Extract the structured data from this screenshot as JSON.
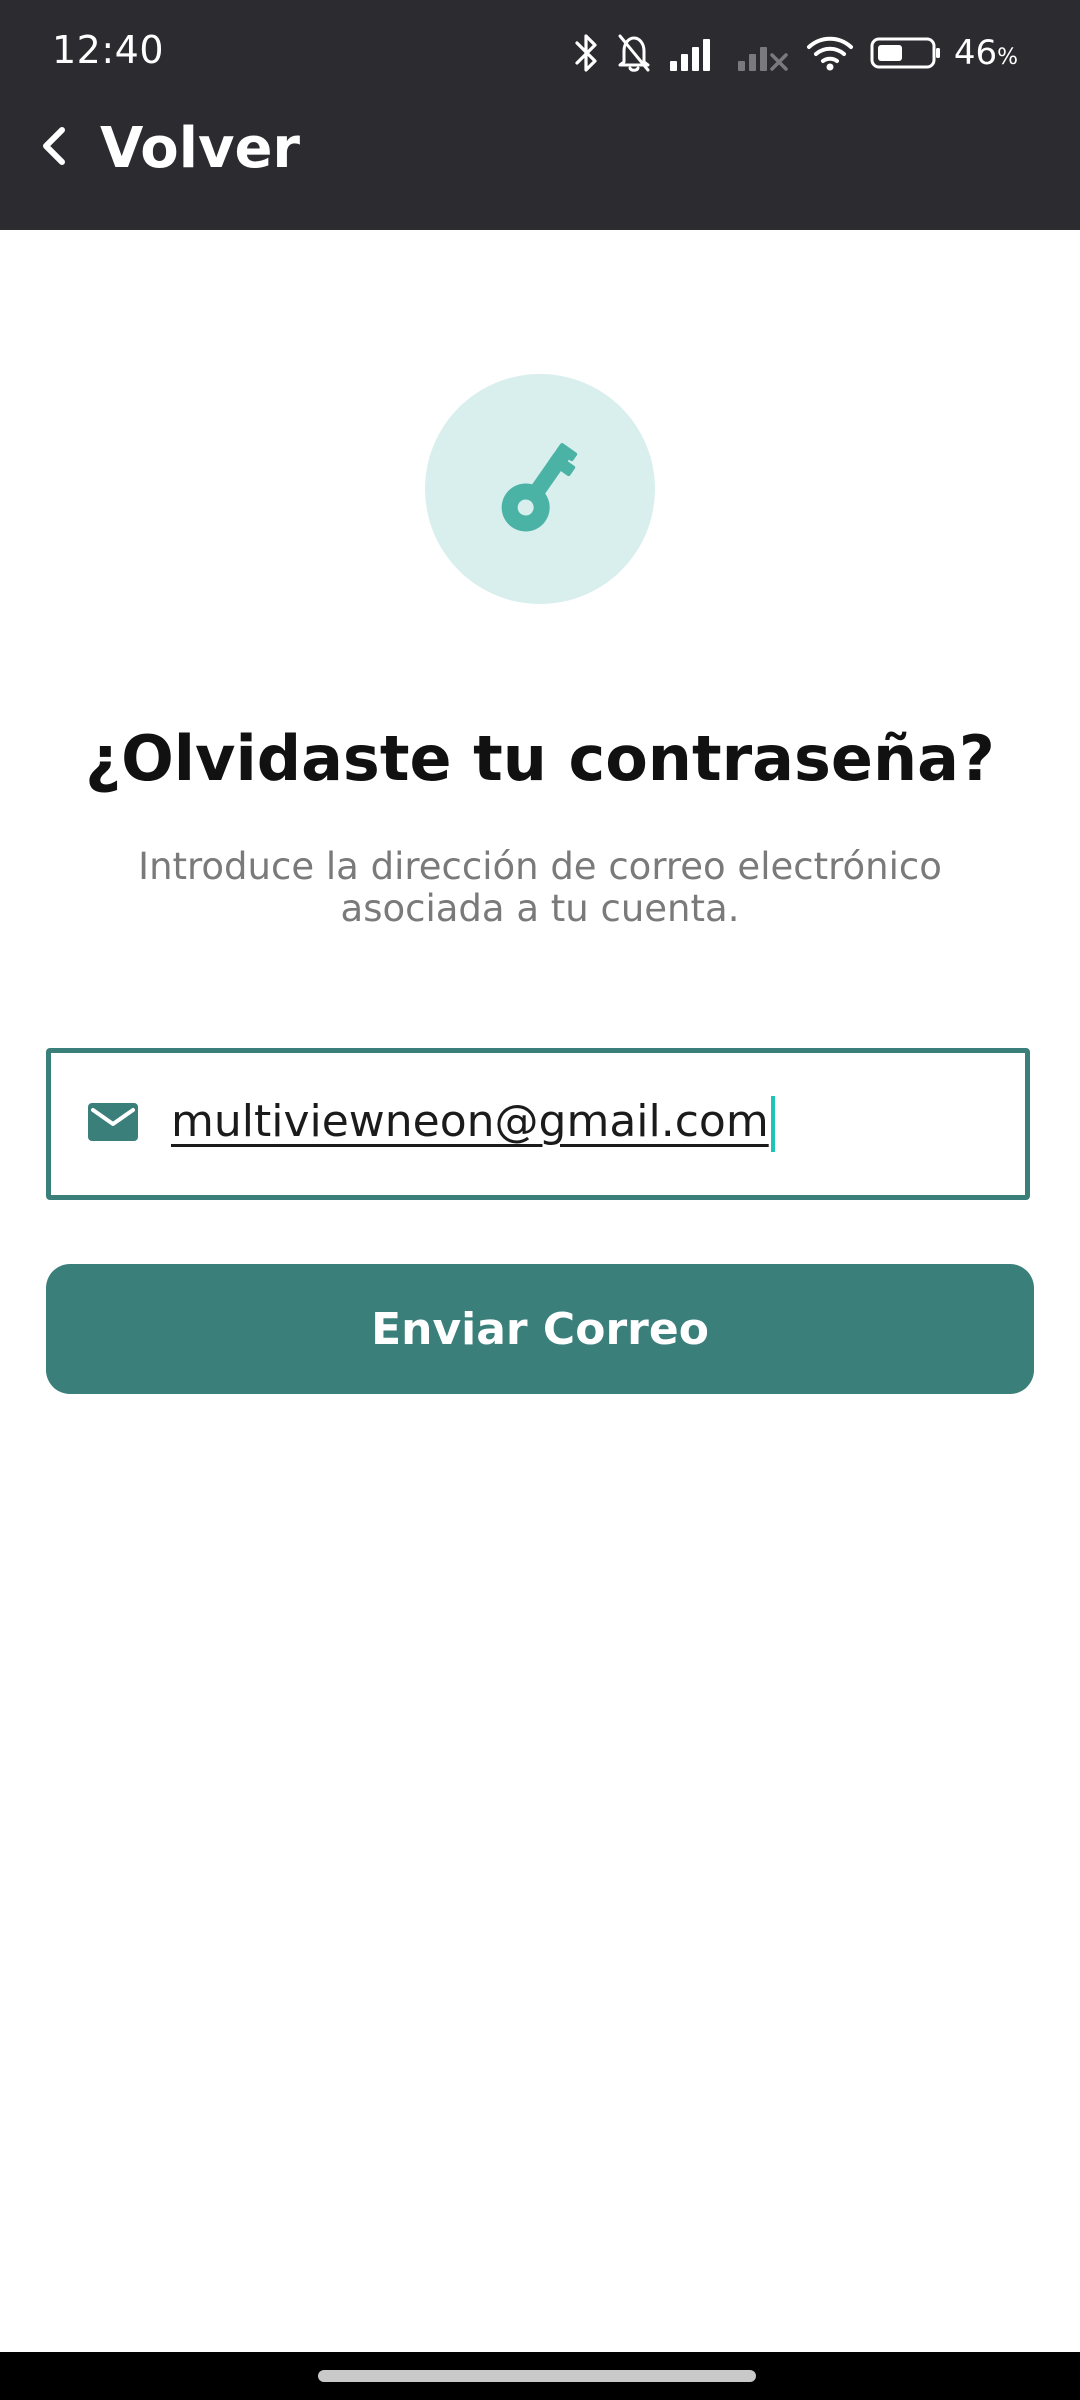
{
  "status_bar": {
    "time": "12:40",
    "battery_percent": "46",
    "battery_unit": "%",
    "icons": [
      "bluetooth-icon",
      "bell-off-icon",
      "signal-icon",
      "signal-no-service-icon",
      "wifi-icon",
      "battery-icon"
    ]
  },
  "app_bar": {
    "back_label": "Volver",
    "back_icon": "chevron-left-icon"
  },
  "illustration": {
    "icon": "key-icon",
    "circle_color": "#d8efed",
    "icon_color": "#4bb3a6"
  },
  "forgot": {
    "title": "¿Olvidaste tu contraseña?",
    "subtitle": "Introduce la dirección de correo electrónico asociada a tu cuenta."
  },
  "email": {
    "icon": "mail-icon",
    "value": "multiviewneon@gmail.com"
  },
  "send_button": {
    "label": "Enviar Correo"
  },
  "colors": {
    "app_bar": "#2b2b30",
    "accent": "#3a7f7a",
    "caret": "#1fc4b4"
  }
}
